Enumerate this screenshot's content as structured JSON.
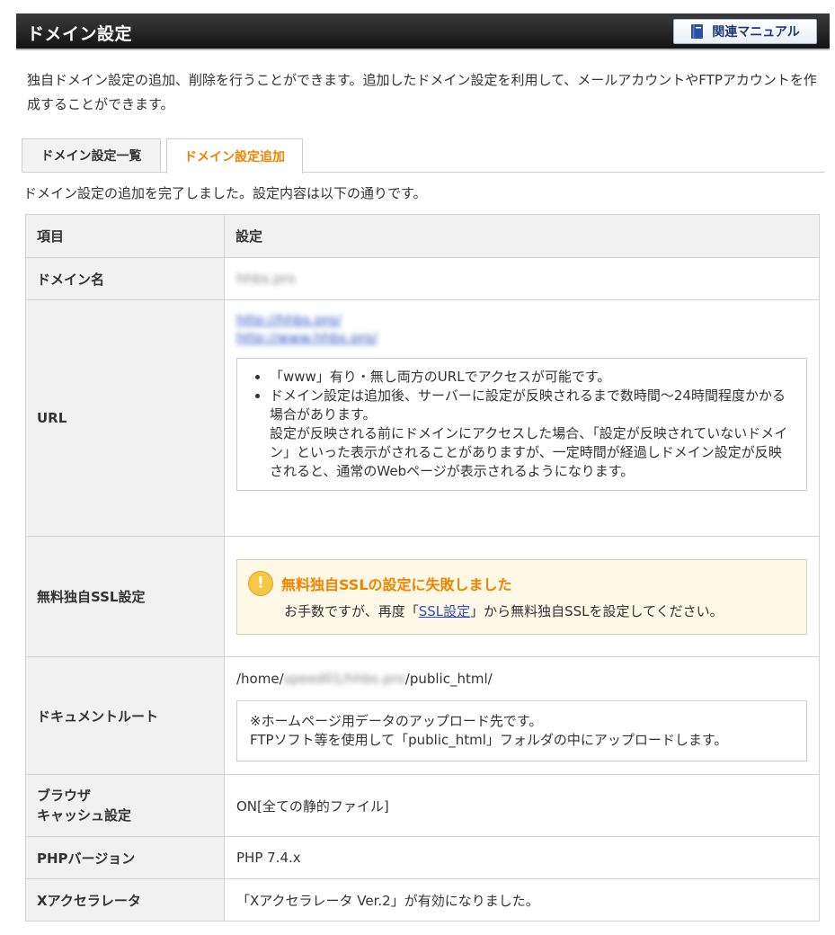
{
  "header": {
    "title": "ドメイン設定",
    "manual_button": "関連マニュアル"
  },
  "intro": "独自ドメイン設定の追加、削除を行うことができます。追加したドメイン設定を利用して、メールアカウントやFTPアカウントを作成することができます。",
  "tabs": [
    {
      "label": "ドメイン設定一覧",
      "active": false
    },
    {
      "label": "ドメイン設定追加",
      "active": true
    }
  ],
  "done_message": "ドメイン設定の追加を完了しました。設定内容は以下の通りです。",
  "table": {
    "header_item": "項目",
    "header_setting": "設定",
    "domain": {
      "label": "ドメイン名",
      "value": "hhbs.pro"
    },
    "url": {
      "label": "URL",
      "links": [
        "http://hhbs.pro/",
        "http://www.hhbs.pro/"
      ],
      "notes": [
        "「www」有り・無し両方のURLでアクセスが可能です。",
        "ドメイン設定は追加後、サーバーに設定が反映されるまで数時間〜24時間程度かかる場合があります。"
      ],
      "notes_extra": "設定が反映される前にドメインにアクセスした場合、「設定が反映されていないドメイン」といった表示がされることがありますが、一定時間が経過しドメイン設定が反映されると、通常のWebページが表示されるようになります。"
    },
    "ssl": {
      "label": "無料独自SSL設定",
      "warn_title": "無料独自SSLの設定に失敗しました",
      "text_before": "お手数ですが、再度「",
      "link": "SSL設定",
      "text_after": "」から無料独自SSLを設定してください。"
    },
    "docroot": {
      "label": "ドキュメントルート",
      "path_prefix": "/home/",
      "path_blur": "speed01/hhbs.pro",
      "path_suffix": "/public_html/",
      "note_line1": "※ホームページ用データのアップロード先です。",
      "note_line2": "FTPソフト等を使用して「public_html」フォルダの中にアップロードします。"
    },
    "cache": {
      "label_line1": "ブラウザ",
      "label_line2": "キャッシュ設定",
      "value": "ON[全ての静的ファイル]"
    },
    "php": {
      "label": "PHPバージョン",
      "value": "PHP 7.4.x"
    },
    "xaccel": {
      "label": "Xアクセラレータ",
      "value": "「Xアクセラレータ Ver.2」が有効になりました。"
    }
  }
}
